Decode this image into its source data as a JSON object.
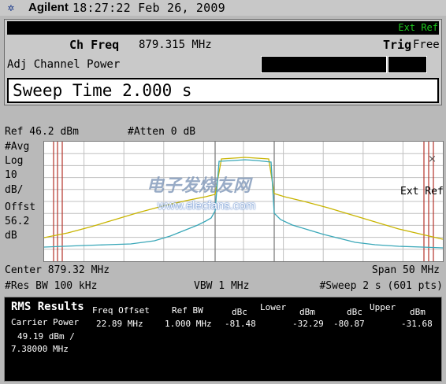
{
  "header": {
    "brand": "Agilent",
    "datetime": "18:27:22  Feb 26, 2009",
    "logo_icon": "agilent-spark-icon"
  },
  "status": {
    "ext_ref": "Ext Ref",
    "ch_freq_label": "Ch Freq",
    "ch_freq_value": "879.315 MHz",
    "trig_label": "Trig",
    "trig_value": "Free",
    "measurement": "Adj Channel Power",
    "sweep_time": "Sweep Time 2.000  s"
  },
  "plot": {
    "ref": "Ref 46.2 dBm",
    "atten": "#Atten 0 dB",
    "left_labels": [
      "#Avg",
      "Log",
      "10",
      "dB/",
      "Offst",
      "56.2",
      "dB"
    ],
    "ext_ref_right": "Ext Ref",
    "marker_symbol": "×",
    "center": "Center 879.32 MHz",
    "span": "Span 50 MHz",
    "res_bw": "#Res BW 100 kHz",
    "vbw": "VBW 1 MHz",
    "sweep": "#Sweep 2 s (601 pts)",
    "trace_colors": {
      "yellow": "#c8b400",
      "cyan": "#39a7b8",
      "marker_lines": "#b4322a"
    }
  },
  "results": {
    "title": "RMS Results",
    "carrier_label": "Carrier Power",
    "carrier_value": "49.19 dBm /",
    "carrier_bw": "7.38000 MHz",
    "headers": {
      "freq_offset": "Freq Offset",
      "ref_bw": "Ref BW",
      "lower": "Lower",
      "upper": "Upper",
      "dbc1": "dBc",
      "dbm1": "dBm",
      "dbc2": "dBc",
      "dbm2": "dBm"
    },
    "row": {
      "freq_offset": "22.89 MHz",
      "ref_bw": "1.000 MHz",
      "lower_dbc": "-81.48",
      "lower_dbm": "-32.29",
      "upper_dbc": "-80.87",
      "upper_dbm": "-31.68"
    }
  },
  "watermark": {
    "cn": "电子发烧友网",
    "url": "www.elecfans.com"
  }
}
